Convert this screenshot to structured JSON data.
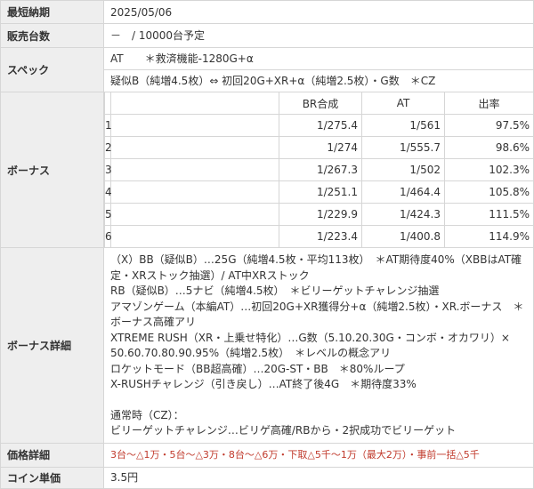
{
  "rows": {
    "earliest": {
      "label": "最短納期",
      "value": "2025/05/06"
    },
    "units": {
      "label": "販売台数",
      "value": "－　/ 10000台予定"
    },
    "spec": {
      "label": "スペック",
      "line1": "AT　　＊救済機能-1280G+α",
      "line2": "疑似B（純増4.5枚）⇔ 初回20G+XR+α（純増2.5枚）・G数　＊CZ"
    },
    "bonus": {
      "label": "ボーナス",
      "headers": [
        "BR合成",
        "AT",
        "出率"
      ],
      "settings": [
        {
          "setting": "1",
          "br": "1/275.4",
          "at": "1/561",
          "rate": "97.5%"
        },
        {
          "setting": "2",
          "br": "1/274",
          "at": "1/555.7",
          "rate": "98.6%"
        },
        {
          "setting": "3",
          "br": "1/267.3",
          "at": "1/502",
          "rate": "102.3%"
        },
        {
          "setting": "4",
          "br": "1/251.1",
          "at": "1/464.4",
          "rate": "105.8%"
        },
        {
          "setting": "5",
          "br": "1/229.9",
          "at": "1/424.3",
          "rate": "111.5%"
        },
        {
          "setting": "6",
          "br": "1/223.4",
          "at": "1/400.8",
          "rate": "114.9%"
        }
      ]
    },
    "bonus_detail": {
      "label": "ボーナス詳細",
      "lines": [
        "（X）BB（疑似B）…25G（純増4.5枚・平均113枚）　＊AT期待度40%（XBBはAT確定・XRストック抽選）/ AT中XRストック",
        "RB（疑似B）…5ナビ（純増4.5枚）　＊ビリーゲットチャレンジ抽選",
        "アマゾンゲーム（本編AT）…初回20G+XR獲得分+α（純増2.5枚）・XR.ボーナス　＊ボーナス高確アリ",
        "XTREME RUSH（XR・上乗せ特化）…G数（5.10.20.30G・コンボ・オカワリ）× 50.60.70.80.90.95%（純増2.5枚）　＊レベルの概念アリ",
        "ロケットモード（BB超高確）…20G-ST・BB　＊80%ループ",
        "X-RUSHチャレンジ（引き戻し）…AT終了後4G　＊期待度33%",
        "",
        "通常時（CZ）：",
        "ビリーゲットチャレンジ…ビリゲ高確/RBから・2択成功でビリーゲット"
      ]
    },
    "price": {
      "label": "価格詳細",
      "value": "3台～△1万・5台～△3万・8台～△6万・下取△5千～1万（最大2万）・事前一括△5千"
    },
    "coin": {
      "label": "コイン単価",
      "value": "3.5円"
    }
  },
  "colors": {
    "header_bg": "#eeeeee",
    "border": "#d6d6d6",
    "price_text": "#c0392b"
  }
}
